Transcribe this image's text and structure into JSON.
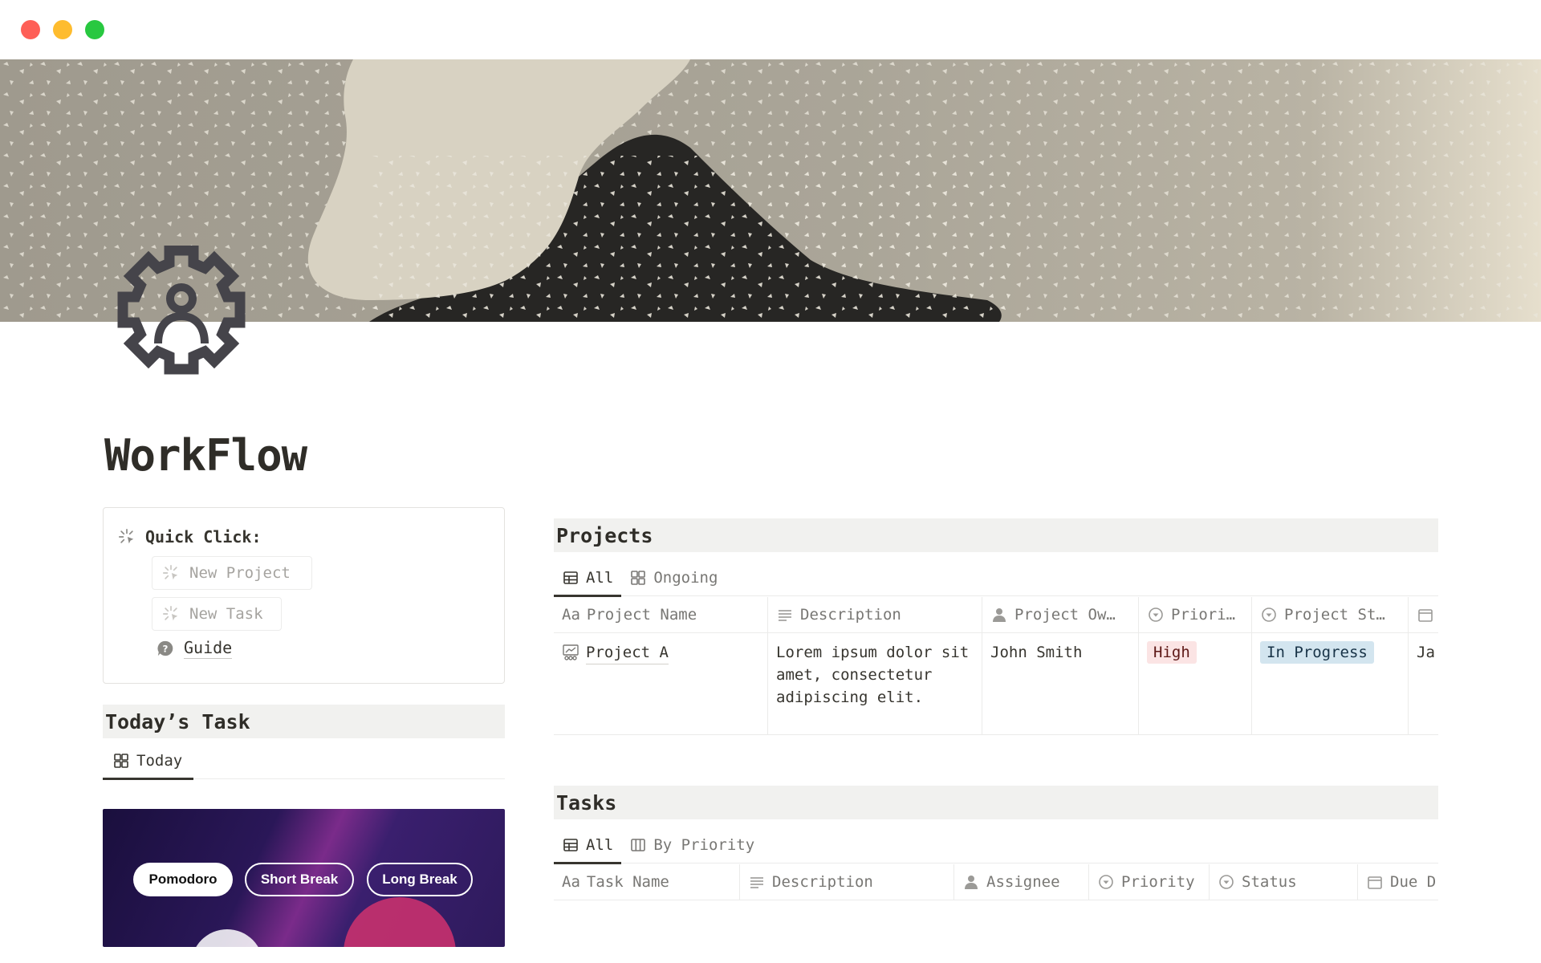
{
  "page": {
    "title": "WorkFlow",
    "icon": "gear-user-icon"
  },
  "quick_click": {
    "label": "Quick Click:",
    "buttons": [
      {
        "label": "New Project"
      },
      {
        "label": "New Task"
      }
    ],
    "guide_label": "Guide"
  },
  "today": {
    "heading": "Today’s Task",
    "tabs": [
      {
        "label": "Today",
        "active": true
      }
    ]
  },
  "pomodoro": {
    "buttons": [
      {
        "label": "Pomodoro",
        "active": true
      },
      {
        "label": "Short Break",
        "active": false
      },
      {
        "label": "Long Break",
        "active": false
      }
    ]
  },
  "projects": {
    "heading": "Projects",
    "tabs": [
      {
        "label": "All",
        "active": true
      },
      {
        "label": "Ongoing",
        "active": false
      }
    ],
    "columns": [
      "Project Name",
      "Description",
      "Project Ow…",
      "Priori…",
      "Project St…",
      ""
    ],
    "column_prefix": "Aa",
    "rows": [
      {
        "name": "Project A",
        "description": "Lorem ipsum dolor sit amet, consectetur adipiscing elit.",
        "owner": "John Smith",
        "priority": "High",
        "status": "In Progress",
        "date": "Ja"
      }
    ]
  },
  "tasks": {
    "heading": "Tasks",
    "tabs": [
      {
        "label": "All",
        "active": true
      },
      {
        "label": "By Priority",
        "active": false
      }
    ],
    "column_prefix": "Aa",
    "columns": [
      "Task Name",
      "Description",
      "Assignee",
      "Priority",
      "Status",
      "Due D"
    ]
  },
  "colors": {
    "tag_high_bg": "#fbe4e4",
    "tag_progress_bg": "#d3e5ef",
    "section_bg": "#f1f1ef"
  }
}
